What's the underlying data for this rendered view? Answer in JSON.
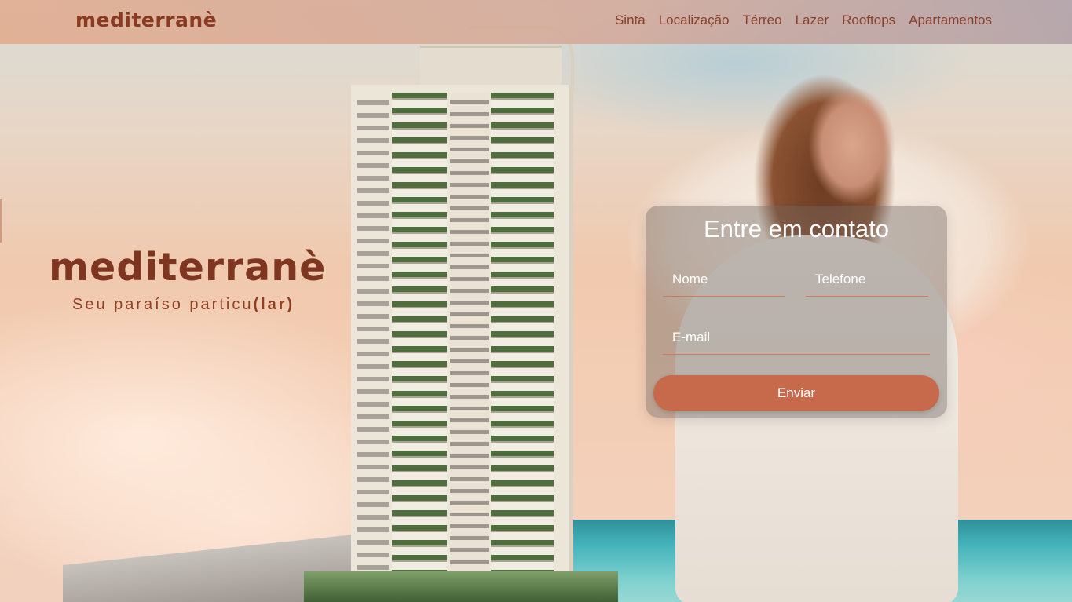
{
  "header": {
    "brand": "mediterranè",
    "nav": [
      {
        "label": "Sinta"
      },
      {
        "label": "Localização"
      },
      {
        "label": "Térreo"
      },
      {
        "label": "Lazer"
      },
      {
        "label": "Rooftops"
      },
      {
        "label": "Apartamentos"
      }
    ]
  },
  "hero": {
    "brand": "mediterranè",
    "tagline_prefix": "Seu paraíso particu",
    "tagline_emphasis": "(lar)"
  },
  "contact_form": {
    "title": "Entre em contato",
    "name_placeholder": "Nome",
    "phone_placeholder": "Telefone",
    "email_placeholder": "E-mail",
    "submit_label": "Enviar"
  },
  "colors": {
    "brand": "#7e3620",
    "accent": "#c66a4b",
    "field_underline": "#d07a5c"
  }
}
